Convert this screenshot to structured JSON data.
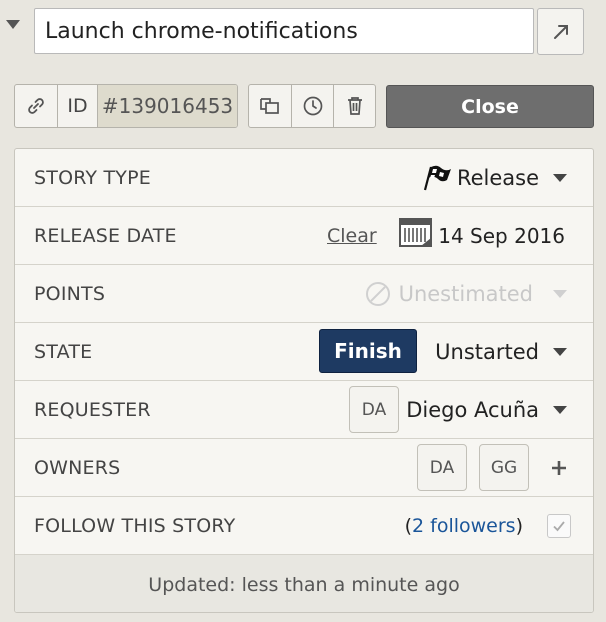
{
  "header": {
    "title_value": "Launch chrome-notifications",
    "expand_icon": "external-link-icon"
  },
  "id_bar": {
    "link_icon": "link-icon",
    "id_label": "ID",
    "id_value": "#139016453"
  },
  "tools": {
    "clone_icon": "clone-icon",
    "history_icon": "clock-icon",
    "delete_icon": "trash-icon"
  },
  "close_label": "Close",
  "fields": {
    "story_type": {
      "label": "STORY TYPE",
      "value": "Release",
      "icon": "flag-icon"
    },
    "release_date": {
      "label": "RELEASE DATE",
      "clear": "Clear",
      "value": "14 Sep 2016",
      "icon": "calendar-icon"
    },
    "points": {
      "label": "POINTS",
      "value": "Unestimated",
      "icon": "no-estimate-icon"
    },
    "state": {
      "label": "STATE",
      "action": "Finish",
      "value": "Unstarted"
    },
    "requester": {
      "label": "REQUESTER",
      "avatar": "DA",
      "value": "Diego Acuña"
    },
    "owners": {
      "label": "OWNERS",
      "avatars": [
        "DA",
        "GG"
      ],
      "add_icon": "plus-icon"
    },
    "follow": {
      "label": "FOLLOW THIS STORY",
      "open_paren": "(",
      "followers": "2 followers",
      "close_paren": ")",
      "checked": true
    }
  },
  "footer": {
    "updated": "Updated: less than a minute ago"
  },
  "colors": {
    "finish": "#1e3a62",
    "close": "#6e6e6e",
    "link": "#1a5599"
  }
}
